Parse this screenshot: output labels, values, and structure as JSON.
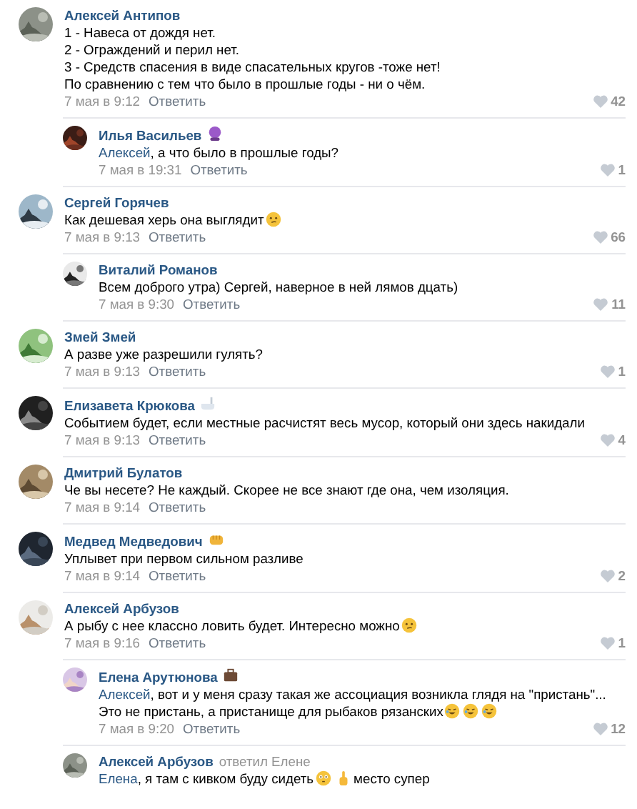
{
  "comments": [
    {
      "author": "Алексей Антипов",
      "body": [
        {
          "kind": "line",
          "text": "1 - Навеса от дождя нет."
        },
        {
          "kind": "line",
          "text": "2 - Ограждений и перил нет."
        },
        {
          "kind": "line",
          "text": "3 - Средств спасения в виде спасательных кругов -тоже нет!"
        },
        {
          "kind": "line",
          "text": "По сравнению с тем что было в прошлые годы - ни о чём."
        }
      ],
      "date": "7 мая в 9:12",
      "reply_label": "Ответить",
      "likes": "42",
      "replies": [
        {
          "author": "Илья Васильев",
          "badge": {
            "kind": "ball"
          },
          "body": [
            {
              "kind": "mention",
              "text": "Алексей"
            },
            {
              "kind": "text",
              "text": ", а что было в прошлые годы?"
            }
          ],
          "date": "7 мая в 19:31",
          "reply_label": "Ответить",
          "likes": "1"
        }
      ]
    },
    {
      "author": "Сергей Горячев",
      "body": [
        {
          "kind": "text",
          "text": "Как дешевая херь она выглядит"
        },
        {
          "kind": "smirk"
        }
      ],
      "date": "7 мая в 9:13",
      "reply_label": "Ответить",
      "likes": "66",
      "replies": [
        {
          "author": "Виталий Романов",
          "body": [
            {
              "kind": "text",
              "text": "Всем доброго утра) Сергей, наверное в ней лямов дцать)"
            }
          ],
          "date": "7 мая в 9:30",
          "reply_label": "Ответить",
          "likes": "11"
        }
      ]
    },
    {
      "author": "Змей Змей",
      "body": [
        {
          "kind": "text",
          "text": "А разве уже разрешили гулять?"
        }
      ],
      "date": "7 мая в 9:13",
      "reply_label": "Ответить",
      "likes": "1"
    },
    {
      "author": "Елизавета Крюкова",
      "badge": {
        "kind": "bath"
      },
      "body": [
        {
          "kind": "text",
          "text": "Событием будет, если местные расчистят весь мусор, который они здесь накидали"
        }
      ],
      "date": "7 мая в 9:13",
      "reply_label": "Ответить",
      "likes": "4"
    },
    {
      "author": "Дмитрий Булатов",
      "body": [
        {
          "kind": "text",
          "text": "Че вы несете? Не каждый. Скорее не все знают где она, чем изоляция."
        }
      ],
      "date": "7 мая в 9:14",
      "reply_label": "Ответить"
    },
    {
      "author": "Медвед Медведович",
      "badge": {
        "kind": "fist"
      },
      "body": [
        {
          "kind": "text",
          "text": "Уплывет при первом сильном разливе"
        }
      ],
      "date": "7 мая в 9:14",
      "reply_label": "Ответить",
      "likes": "2"
    },
    {
      "author": "Алексей Арбузов",
      "body": [
        {
          "kind": "text",
          "text": "А рыбу с нее классно ловить будет. Интересно можно"
        },
        {
          "kind": "smirk"
        }
      ],
      "date": "7 мая в 9:16",
      "reply_label": "Ответить",
      "likes": "1",
      "replies": [
        {
          "author": "Елена Арутюнова",
          "badge": {
            "kind": "briefcase"
          },
          "body": [
            {
              "kind": "mention",
              "text": "Алексей"
            },
            {
              "kind": "text",
              "text": ", вот и у меня сразу такая же ассоциация возникла глядя на \"пристань\"... Это не пристань, а пристанище для рыбаков рязанских"
            },
            {
              "kind": "laugh"
            },
            {
              "kind": "laugh"
            },
            {
              "kind": "laugh"
            }
          ],
          "date": "7 мая в 9:20",
          "reply_label": "Ответить",
          "likes": "12"
        },
        {
          "author": "Алексей Арбузов",
          "reply_to": "ответил Елене",
          "body": [
            {
              "kind": "mention",
              "text": "Елена"
            },
            {
              "kind": "text",
              "text": ", я там с кивком буду сидеть"
            },
            {
              "kind": "flushed"
            },
            {
              "kind": "finger"
            },
            {
              "kind": "text",
              "text": "место супер"
            }
          ]
        }
      ]
    }
  ]
}
